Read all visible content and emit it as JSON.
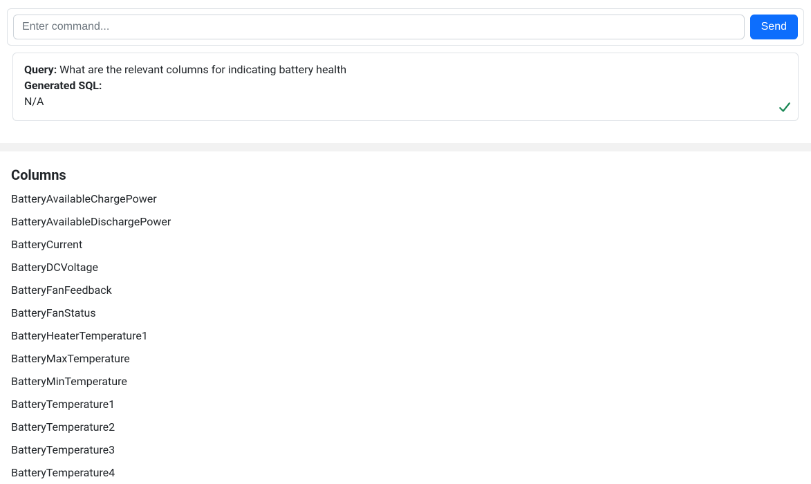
{
  "input": {
    "placeholder": "Enter command...",
    "send_label": "Send"
  },
  "result": {
    "query_label": "Query:",
    "query_value": "What are the relevant columns for indicating battery health",
    "sql_label": "Generated SQL:",
    "sql_value": "N/A"
  },
  "columns": {
    "heading": "Columns",
    "items": [
      "BatteryAvailableChargePower",
      "BatteryAvailableDischargePower",
      "BatteryCurrent",
      "BatteryDCVoltage",
      "BatteryFanFeedback",
      "BatteryFanStatus",
      "BatteryHeaterTemperature1",
      "BatteryMaxTemperature",
      "BatteryMinTemperature",
      "BatteryTemperature1",
      "BatteryTemperature2",
      "BatteryTemperature3",
      "BatteryTemperature4"
    ]
  }
}
